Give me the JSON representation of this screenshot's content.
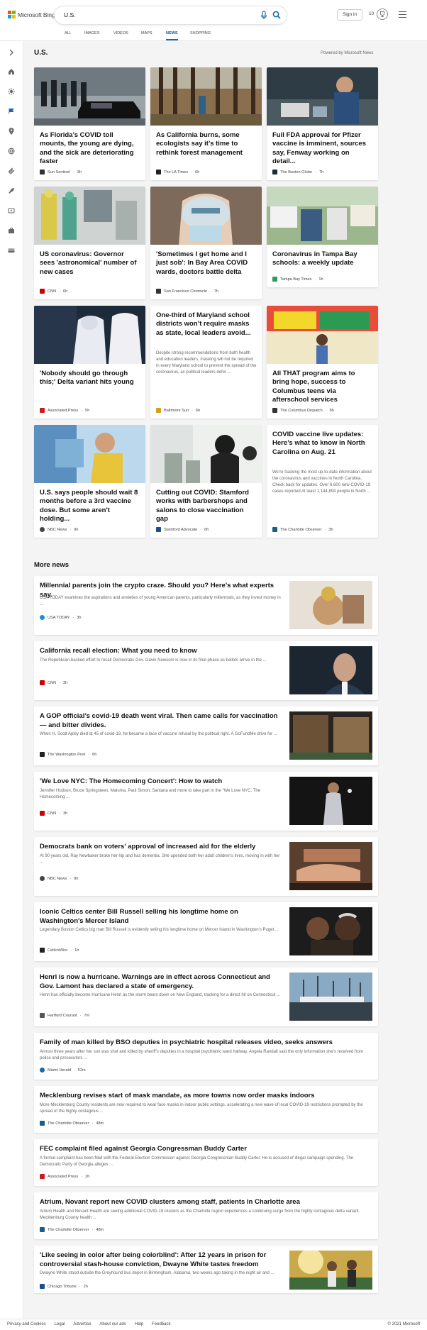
{
  "header": {
    "brand": "Microsoft Bing",
    "search_value": "U.S.",
    "sign_in": "Sign in",
    "rewards_count": "10",
    "tabs": [
      "ALL",
      "IMAGES",
      "VIDEOS",
      "MAPS",
      "NEWS",
      "SHOPPING"
    ],
    "active_tab": "NEWS"
  },
  "colors": {
    "accent": "#1a6aa8",
    "ms_red": "#f25022",
    "ms_green": "#7fba00",
    "ms_blue": "#00a4ef",
    "ms_yellow": "#ffb900"
  },
  "sidebar": {
    "icons": [
      "expand-icon",
      "home-icon",
      "covid-icon",
      "flag-icon",
      "location-icon",
      "globe-icon",
      "science-icon",
      "rocket-icon",
      "entertainment-icon",
      "business-icon",
      "money-icon"
    ]
  },
  "main": {
    "title": "U.S.",
    "powered_by": "Powered by Microsoft News",
    "cards": [
      {
        "title": "As Florida’s COVID toll mounts, the young are dying, and the sick are deteriorating faster",
        "source": "Sun Sentinel",
        "age": "3h"
      },
      {
        "title": "As California burns, some ecologists say it’s time to rethink forest management",
        "source": "The LA Times",
        "age": "6h"
      },
      {
        "title": "Full FDA approval for Pfizer vaccine is imminent, sources say, Fenway working on detail...",
        "source": "The Boston Globe",
        "age": "7h"
      },
      {
        "title": "US coronavirus: Governor sees 'astronomical' number of new cases",
        "source": "CNN",
        "age": "6h"
      },
      {
        "title": "'Sometimes I get home and I just sob': In Bay Area COVID wards, doctors battle delta",
        "source": "San Francisco Chronicle",
        "age": "7h"
      },
      {
        "title": "Coronavirus in Tampa Bay schools: a weekly update",
        "source": "Tampa Bay Times",
        "age": "1h"
      },
      {
        "title": "'Nobody should go through this;' Delta variant hits young",
        "source": "Associated Press",
        "age": "5h"
      },
      {
        "title": "One-third of Maryland school districts won’t require masks as state, local leaders avoid...",
        "snippet": "Despite strong recommendations from both health and education leaders, masking will not be required in every Maryland school to prevent the spread of the coronavirus, as political leaders defer ...",
        "source": "Baltimore Sun",
        "age": "6h"
      },
      {
        "title": "All THAT program aims to bring hope, success to Columbus teens via afterschool services",
        "source": "The Columbus Dispatch",
        "age": "8h"
      },
      {
        "title": "U.S. says people should wait 8 months before a 3rd vaccine dose. But some aren't holding...",
        "source": "NBC News",
        "age": "9h"
      },
      {
        "title": "Cutting out COVID: Stamford works with barbershops and salons to close vaccination gap",
        "source": "Stamford Advocate",
        "age": "8h"
      },
      {
        "title": "COVID vaccine live updates: Here’s what to know in North Carolina on Aug. 21",
        "snippet": "We’re tracking the most up-to-date information about the coronavirus and vaccines in North Carolina. Check back for updates. Over 6,600 new COVID-19 cases reported At least 1,144,894 people in North ...",
        "source": "The Charlotte Observer",
        "age": "3h"
      }
    ]
  },
  "more_news": {
    "title": "More news",
    "items": [
      {
        "title": "Millennial parents join the crypto craze. Should you? Here's what experts say.",
        "snippet": "USA TODAY examines the aspirations and anxieties of young American parents, particularly millennials, as they invest money in ...",
        "source": "USA TODAY",
        "age": "3h"
      },
      {
        "title": "California recall election: What you need to know",
        "snippet": "The Republican-backed effort to recall Democratic Gov. Gavin Newsom is now in its final phase as ballots arrive in the ...",
        "source": "CNN",
        "age": "3h"
      },
      {
        "title": "A GOP official’s covid-19 death went viral. Then came calls for vaccination — and bitter divides.",
        "snippet": "When H. Scott Apley died at 45 of covid-19, he became a face of vaccine refusal by the political right. A GoFundMe drive for ...",
        "source": "The Washington Post",
        "age": "6h"
      },
      {
        "title": "'We Love NYC: The Homecoming Concert': How to watch",
        "snippet": "Jennifer Hudson, Bruce Springsteen, Maluma, Paul Simon, Santana and more to take part in the \"We Love NYC: The Homecoming ...",
        "source": "CNN",
        "age": "3h"
      },
      {
        "title": "Democrats bank on voters' approval of increased aid for the elderly",
        "snippet": "At 90 years old, Ray Newbaker broke her hip and has dementia. She upended both her adult children’s lives, moving in with her ...",
        "source": "NBC News",
        "age": "9h"
      },
      {
        "title": "Iconic Celtics center Bill Russell selling his longtime home on Washington's Mercer Island",
        "snippet": "Legendary Boston Celtics big man Bill Russell is evidently selling his longtime home on Mercer Island in Washington’s Puget ...",
        "source": "CelticsWire",
        "age": "1h"
      },
      {
        "title": "Henri is now a hurricane. Warnings are in effect across Connecticut and Gov. Lamont has declared a state of emergency.",
        "snippet": "Henri has officially become Hurricane Henri as the storm bears down on New England, tracking for a direct hit on Connecticut ...",
        "source": "Hartford Courant",
        "age": "7m"
      },
      {
        "title": "Family of man killed by BSO deputies in psychiatric hospital releases video, seeks answers",
        "snippet": "Almost three years after her son was shot and killed by sheriff’s deputies in a hospital psychiatric ward hallway, Angela Randall said the only information she’s received from police and prosecutors ...",
        "source": "Miami Herald",
        "age": "52m"
      },
      {
        "title": "Mecklenburg revises start of mask mandate, as more towns now order masks indoors",
        "snippet": "More Mecklenburg County residents are now required to wear face masks in indoor public settings, accelerating a new wave of local COVID-19 restrictions prompted by the spread of the highly contagious ...",
        "source": "The Charlotte Observer",
        "age": "48m"
      },
      {
        "title": "FEC complaint filed against Georgia Congressman Buddy Carter",
        "snippet": "A formal complaint has been filed with the Federal Election Commission against Georgia Congressman Buddy Carter. He is accused of illegal campaign spending. The Democratic Party of Georgia alleges ...",
        "source": "Associated Press",
        "age": "2h"
      },
      {
        "title": "Atrium, Novant report new COVID clusters among staff, patients in Charlotte area",
        "snippet": "Atrium Health and Novant Health are seeing additional COVID-19 clusters as the Charlotte region experiences a continuing surge from the highly contagious delta variant. Mecklenburg County health ...",
        "source": "The Charlotte Observer",
        "age": "48m"
      },
      {
        "title": "'Like seeing in color after being colorblind': After 12 years in prison for controversial stash-house conviction, Dwayne White tastes freedom",
        "snippet": "Dwayne White stood outside the Greyhound bus depot in Birmingham, Alabama, two weeks ago taking in the night air and ...",
        "source": "Chicago Tribune",
        "age": "2h"
      }
    ]
  },
  "footer": {
    "links": [
      "Privacy and Cookies",
      "Legal",
      "Advertise",
      "About our ads",
      "Help",
      "Feedback"
    ],
    "copyright": "© 2021 Microsoft"
  }
}
